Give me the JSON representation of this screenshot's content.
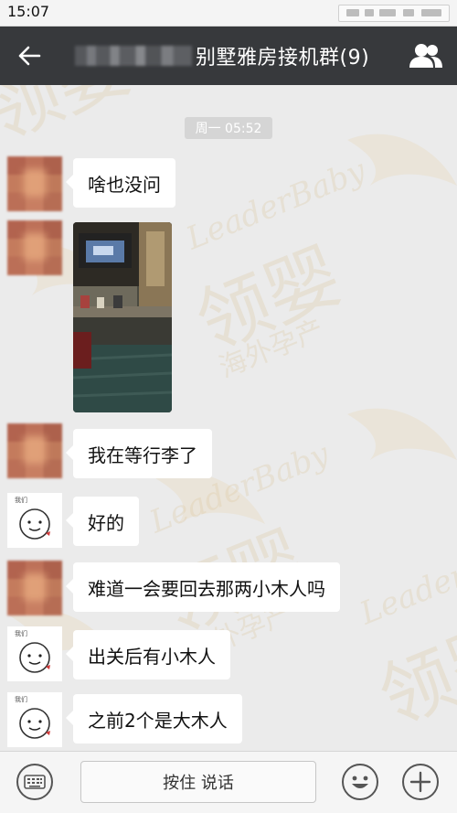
{
  "status_bar": {
    "time": "15:07"
  },
  "header": {
    "title": "别墅雅房接机群(9)",
    "back_icon": "arrow-left-icon",
    "members_icon": "people-icon"
  },
  "chat": {
    "timestamp": "周一 05:52",
    "messages": [
      {
        "avatar": "pixelated-avatar",
        "type": "text",
        "text": "啥也没问"
      },
      {
        "avatar": "pixelated-avatar",
        "type": "image",
        "description": "airport baggage claim photo"
      },
      {
        "avatar": "pixelated-avatar",
        "type": "text",
        "text": "我在等行李了"
      },
      {
        "avatar": "cartoon-avatar",
        "type": "text",
        "text": "好的"
      },
      {
        "avatar": "pixelated-avatar",
        "type": "text",
        "text": "难道一会要回去那两小木人吗"
      },
      {
        "avatar": "cartoon-avatar",
        "type": "text",
        "text": "出关后有小木人"
      },
      {
        "avatar": "cartoon-avatar",
        "type": "text",
        "text": "之前2个是大木人"
      }
    ]
  },
  "watermark": {
    "latin": "LeaderBaby",
    "large": "领婴",
    "small": "海外孕产",
    "color": "#e8cf9a"
  },
  "input_bar": {
    "hold_to_talk": "按住 说话",
    "keyboard_icon": "keyboard-icon",
    "emoji_icon": "emoji-icon",
    "plus_icon": "plus-icon"
  },
  "colors": {
    "title_bar": "#37393c",
    "background": "#ebebeb",
    "bubble": "#ffffff"
  }
}
